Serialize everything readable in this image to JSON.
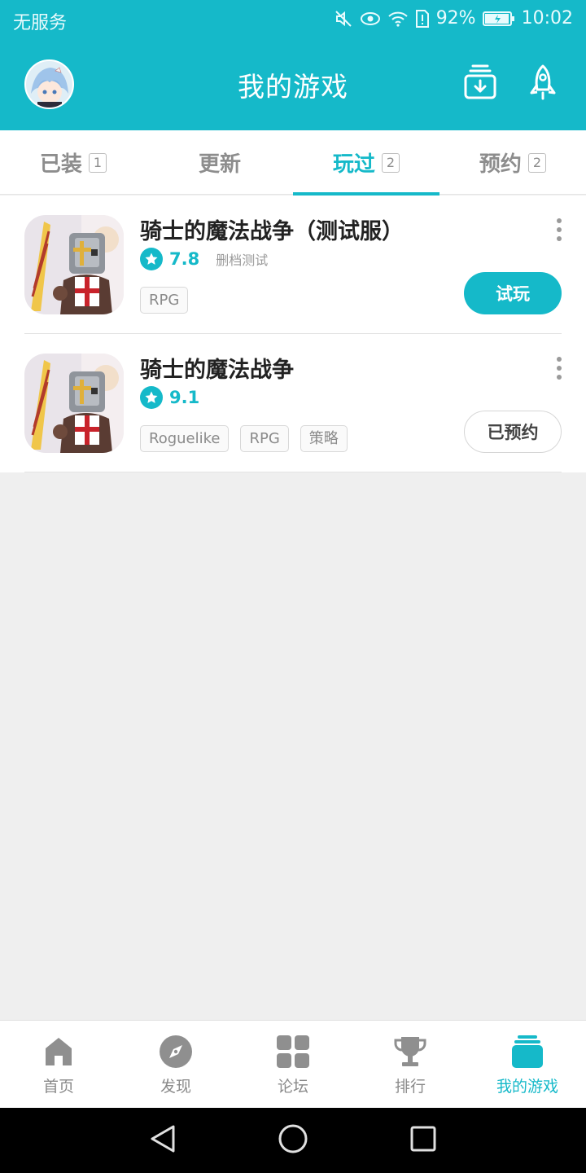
{
  "status": {
    "carrier": "无服务",
    "battery": "92%",
    "time": "10:02"
  },
  "header": {
    "title": "我的游戏",
    "icons": [
      "download-box-icon",
      "rocket-icon"
    ]
  },
  "tabs": [
    {
      "label": "已装",
      "count": "1"
    },
    {
      "label": "更新",
      "count": ""
    },
    {
      "label": "玩过",
      "count": "2",
      "active": true
    },
    {
      "label": "预约",
      "count": "2"
    }
  ],
  "games": [
    {
      "title": "骑士的魔法战争（测试服）",
      "score": "7.8",
      "meta": "删档测试",
      "tags": [
        "RPG"
      ],
      "action": "试玩"
    },
    {
      "title": "骑士的魔法战争",
      "score": "9.1",
      "meta": "",
      "tags": [
        "Roguelike",
        "RPG",
        "策略"
      ],
      "action": "已预约"
    }
  ],
  "bottom_nav": [
    {
      "label": "首页",
      "icon": "home-icon"
    },
    {
      "label": "发现",
      "icon": "compass-icon"
    },
    {
      "label": "论坛",
      "icon": "grid-icon"
    },
    {
      "label": "排行",
      "icon": "trophy-icon"
    },
    {
      "label": "我的游戏",
      "icon": "game-stack-icon",
      "active": true
    }
  ],
  "colors": {
    "accent": "#15b9c9",
    "background": "#efefef"
  }
}
